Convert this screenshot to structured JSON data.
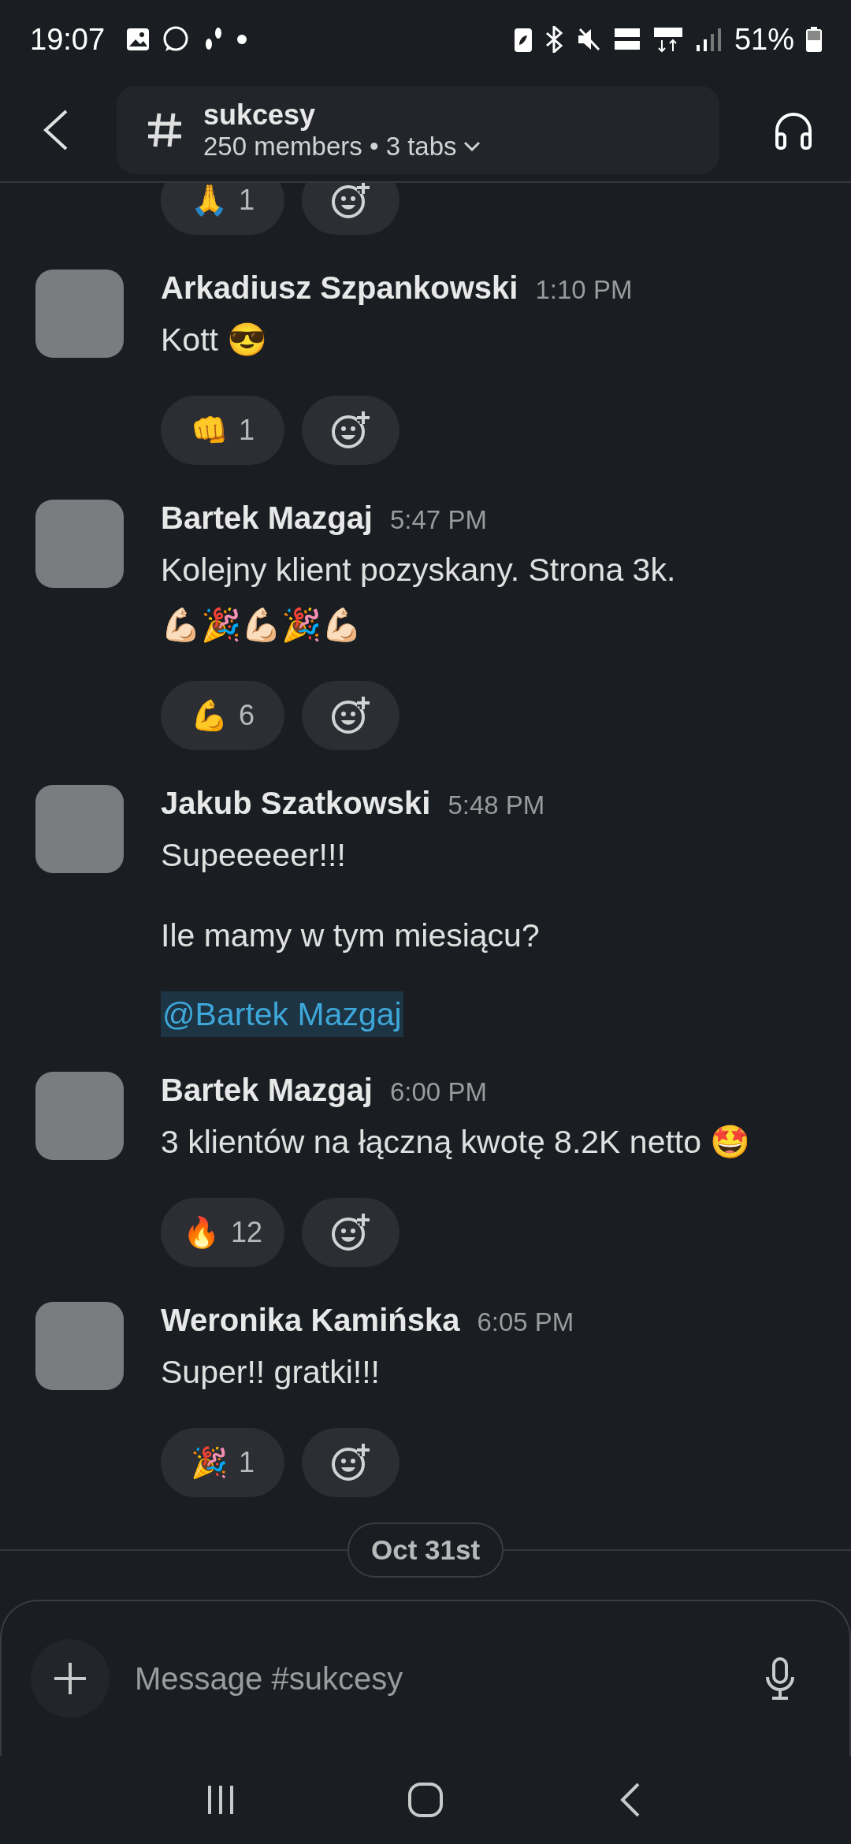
{
  "status_bar": {
    "time": "19:07",
    "battery": "51%"
  },
  "header": {
    "channel": "sukcesy",
    "subtitle": "250 members • 3 tabs"
  },
  "partial_reactions": [
    {
      "emoji": "🙏",
      "count": "1"
    }
  ],
  "messages": [
    {
      "author": "Arkadiusz Szpankowski",
      "time": "1:10 PM",
      "paragraphs": [
        {
          "kind": "text",
          "lines": [
            "Kott 😎"
          ]
        }
      ],
      "reactions": [
        {
          "emoji": "👊",
          "count": "1"
        }
      ]
    },
    {
      "author": "Bartek Mazgaj",
      "time": "5:47 PM",
      "paragraphs": [
        {
          "kind": "text",
          "lines": [
            "Kolejny klient pozyskany. Strona 3k.",
            "💪🏻🎉💪🏻🎉💪🏻"
          ]
        }
      ],
      "reactions": [
        {
          "emoji": "💪",
          "count": "6"
        }
      ]
    },
    {
      "author": "Jakub Szatkowski",
      "time": "5:48 PM",
      "paragraphs": [
        {
          "kind": "text",
          "lines": [
            "Supeeeeer!!!"
          ]
        },
        {
          "kind": "text",
          "lines": [
            "Ile mamy w tym miesiącu?"
          ]
        },
        {
          "kind": "mention",
          "lines": [
            "@Bartek Mazgaj"
          ]
        }
      ]
    },
    {
      "author": "Bartek Mazgaj",
      "time": "6:00 PM",
      "paragraphs": [
        {
          "kind": "text",
          "lines": [
            "3 klientów na łączną kwotę 8.2K netto 🤩"
          ]
        }
      ],
      "reactions": [
        {
          "emoji": "🔥",
          "count": "12"
        }
      ]
    },
    {
      "author": "Weronika Kamińska",
      "time": "6:05 PM",
      "paragraphs": [
        {
          "kind": "text",
          "lines": [
            "Super!! gratki!!!"
          ]
        }
      ],
      "reactions": [
        {
          "emoji": "🎉",
          "count": "1"
        }
      ]
    }
  ],
  "date_divider": "Oct 31st",
  "composer": {
    "placeholder": "Message #sukcesy"
  }
}
